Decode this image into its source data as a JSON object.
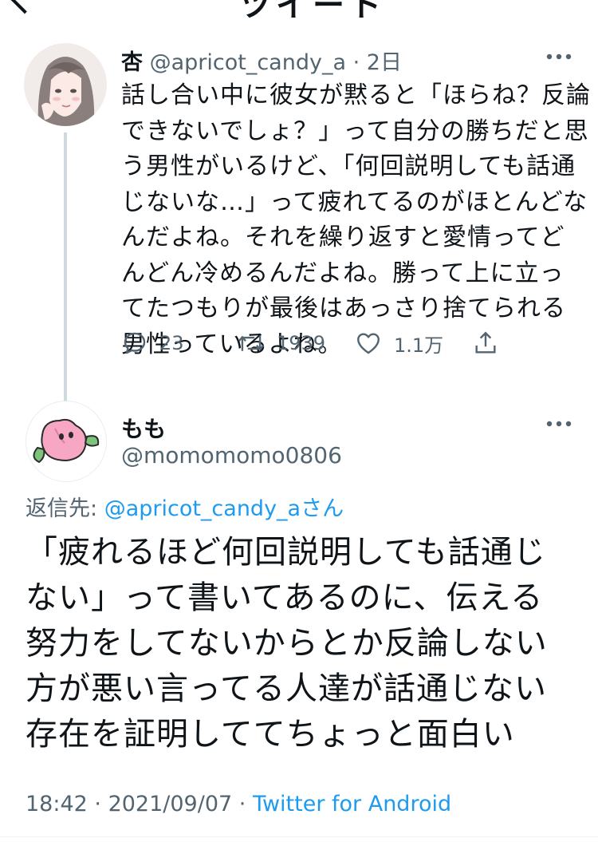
{
  "header": {
    "title_fragment": "ツイート"
  },
  "parent_tweet": {
    "name": "杏",
    "handle": "@apricot_candy_a",
    "separator": "·",
    "time": "2日",
    "body_lines": [
      "話し合い中に彼女が黙ると「ほらね？反論",
      "できないでしょ？」って自分の勝ちだと思",
      "う男性がいるけど、「何回説明しても話通",
      "じないな…」って疲れてるのがほとんどな",
      "んだよね。それを繰り返すと愛情ってど",
      "んどん冷めるんだよね。勝って上に立っ",
      "てたつもりが最後はあっさり捨てられる",
      "男性っているよね。"
    ],
    "reply_count": "23",
    "retweet_count": "1939",
    "like_count": "1.1万",
    "icons": [
      "reply-icon",
      "retweet-icon",
      "like-icon",
      "share-icon",
      "more-icon"
    ]
  },
  "main_tweet": {
    "name": "もも",
    "handle": "@momomomo0806",
    "reply_label": "返信先: ",
    "reply_target": "@apricot_candy_aさん",
    "body_lines": [
      "「疲れるほど何回説明しても話通じ",
      "ない」って書いてあるのに、伝える",
      "努力をしてないからとか反論しない",
      "方が悪い言ってる人達が話通じない",
      "存在を証明しててちょっと面白い"
    ],
    "time": "18:42",
    "separator1": " · ",
    "date": "2021/09/07",
    "separator2": " · ",
    "source": "Twitter for Android"
  },
  "colors": {
    "text": "#0f1419",
    "secondary": "#536471",
    "link": "#1d9bf0",
    "thread_line": "#cfd9de"
  }
}
